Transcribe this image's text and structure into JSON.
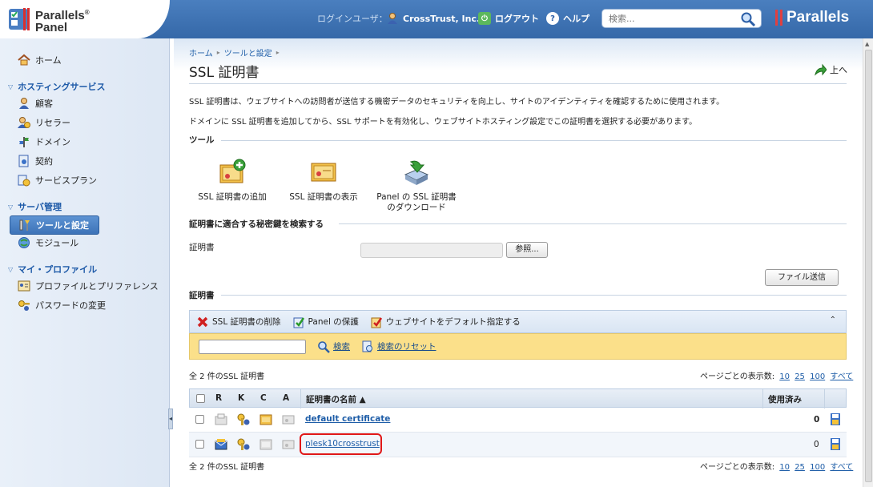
{
  "header": {
    "logo_line1": "Parallels",
    "logo_line2": "Panel",
    "login_label": "ログインユーザ：",
    "user_name": "CrossTrust, Inc.",
    "logout": "ログアウト",
    "help": "ヘルプ",
    "search_placeholder": "検索...",
    "brand": "Parallels"
  },
  "sidebar": {
    "home": "ホーム",
    "hosting_section": "ホスティングサービス",
    "customers": "顧客",
    "resellers": "リセラー",
    "domains": "ドメイン",
    "subscriptions": "契約",
    "service_plans": "サービスプラン",
    "server_section": "サーバ管理",
    "tools_settings": "ツールと設定",
    "modules": "モジュール",
    "profile_section": "マイ・プロファイル",
    "profile_prefs": "プロファイルとプリファレンス",
    "change_password": "パスワードの変更"
  },
  "main": {
    "breadcrumb": [
      "ホーム",
      "ツールと設定"
    ],
    "title": "SSL 証明書",
    "up_label": "上へ",
    "desc1": "SSL 証明書は、ウェブサイトへの訪問者が送信する機密データのセキュリティを向上し、サイトのアイデンティティを確認するために使用されます。",
    "desc2": "ドメインに SSL 証明書を追加してから、SSL サポートを有効化し、ウェブサイトホスティング設定でこの証明書を選択する必要があります。",
    "tools_title": "ツール",
    "tool_add": "SSL 証明書の追加",
    "tool_view": "SSL 証明書の表示",
    "tool_download_1": "Panel の SSL 証明書",
    "tool_download_2": "のダウンロード",
    "key_search_title": "証明書に適合する秘密鍵を検索する",
    "cert_label": "証明書",
    "browse_button": "参照...",
    "send_file_button": "ファイル送信",
    "certs_title": "証明書",
    "toolbar": {
      "delete": "SSL 証明書の削除",
      "protect": "Panel の保護",
      "default": "ウェブサイトをデフォルト指定する"
    },
    "filter": {
      "search": "検索",
      "reset": "検索のリセット"
    },
    "count_text": "全 2 件のSSL 証明書",
    "per_page_label": "ページごとの表示数:",
    "per_page_options": [
      "10",
      "25",
      "100",
      "すべて"
    ],
    "table": {
      "headers": {
        "r": "R",
        "k": "K",
        "c": "C",
        "a": "A",
        "name": "証明書の名前 ▲",
        "used": "使用済み"
      },
      "rows": [
        {
          "name": "default certificate",
          "used": "0"
        },
        {
          "name": "plesk10crosstrust",
          "used": "0"
        }
      ]
    }
  },
  "colors": {
    "header_blue": "#3a6fb0",
    "link_blue": "#1f5ea8",
    "filter_yellow": "#fbe08a",
    "highlight_red": "#e01818"
  }
}
